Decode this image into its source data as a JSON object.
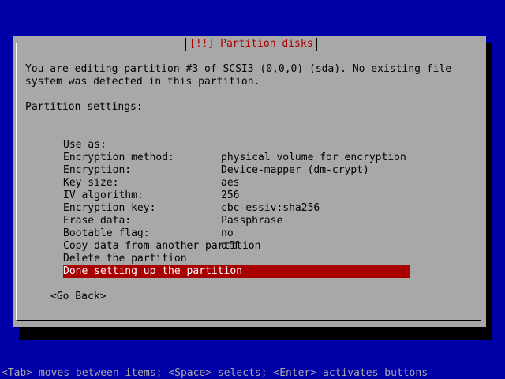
{
  "dialog": {
    "title": "[!!] Partition disks",
    "intro_line1": "You are editing partition #3 of SCSI3 (0,0,0) (sda). No existing file",
    "intro_line2": "system was detected in this partition.",
    "settings_header": "Partition settings:",
    "settings": [
      {
        "label": "Use as:",
        "value": "physical volume for encryption"
      },
      {
        "label": "Encryption method:",
        "value": "Device-mapper (dm-crypt)"
      },
      {
        "label": "Encryption:",
        "value": "aes"
      },
      {
        "label": "Key size:",
        "value": "256"
      },
      {
        "label": "IV algorithm:",
        "value": "cbc-essiv:sha256"
      },
      {
        "label": "Encryption key:",
        "value": "Passphrase"
      },
      {
        "label": "Erase data:",
        "value": "no"
      },
      {
        "label": "Bootable flag:",
        "value": "off"
      }
    ],
    "actions": [
      "Copy data from another partition",
      "Delete the partition",
      "Done setting up the partition"
    ],
    "go_back": "<Go Back>"
  },
  "help_line": "<Tab> moves between items; <Space> selects; <Enter> activates buttons",
  "colors": {
    "background": "#0000a8",
    "dialog": "#a8a8a8",
    "title": "#a80000",
    "selection": "#a80000"
  }
}
